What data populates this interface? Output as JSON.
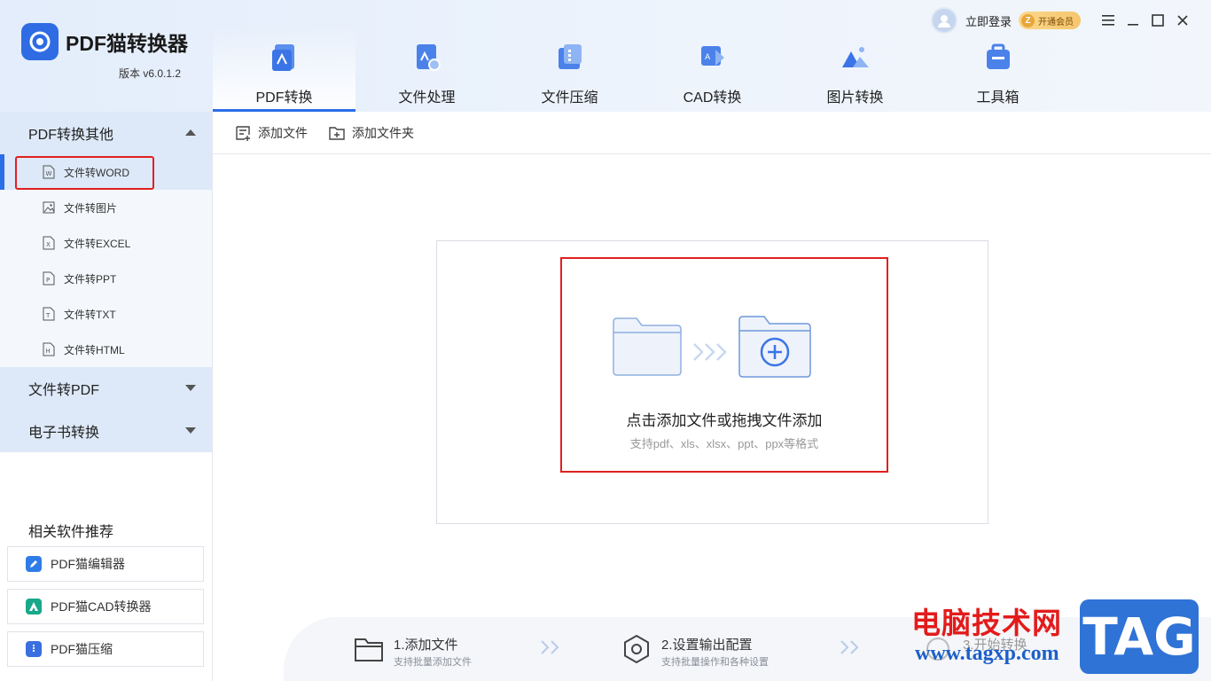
{
  "app": {
    "name": "PDF猫转换器",
    "version": "版本 v6.0.1.2"
  },
  "top_right": {
    "login": "立即登录",
    "vip_icon": "Z",
    "vip": "开通会员"
  },
  "nav_tabs": [
    {
      "label": "PDF转换",
      "icon": "pdf-convert-icon",
      "active": true
    },
    {
      "label": "文件处理",
      "icon": "file-process-icon",
      "active": false
    },
    {
      "label": "文件压缩",
      "icon": "file-compress-icon",
      "active": false
    },
    {
      "label": "CAD转换",
      "icon": "cad-convert-icon",
      "active": false
    },
    {
      "label": "图片转换",
      "icon": "image-convert-icon",
      "active": false
    },
    {
      "label": "工具箱",
      "icon": "toolbox-icon",
      "active": false
    }
  ],
  "sidebar": {
    "groups": [
      {
        "label": "PDF转换其他",
        "expanded": true
      },
      {
        "label": "文件转PDF",
        "expanded": false
      },
      {
        "label": "电子书转换",
        "expanded": false
      }
    ],
    "items": [
      {
        "label": "文件转WORD",
        "icon_letter": "W",
        "active": true
      },
      {
        "label": "文件转图片",
        "icon_letter": "",
        "active": false
      },
      {
        "label": "文件转EXCEL",
        "icon_letter": "X",
        "active": false
      },
      {
        "label": "文件转PPT",
        "icon_letter": "P",
        "active": false
      },
      {
        "label": "文件转TXT",
        "icon_letter": "T",
        "active": false
      },
      {
        "label": "文件转HTML",
        "icon_letter": "H",
        "active": false
      }
    ],
    "recommend_title": "相关软件推荐",
    "recommend": [
      {
        "label": "PDF猫编辑器",
        "color": "#2f7ce8"
      },
      {
        "label": "PDF猫CAD转换器",
        "color": "#19a889"
      },
      {
        "label": "PDF猫压缩",
        "color": "#3a6fe0"
      }
    ]
  },
  "toolbar": {
    "add_file": "添加文件",
    "add_folder": "添加文件夹"
  },
  "drop_zone": {
    "title": "点击添加文件或拖拽文件添加",
    "subtitle": "支持pdf、xls、xlsx、ppt、ppx等格式"
  },
  "steps": [
    {
      "title": "1.添加文件",
      "sub": "支持批量添加文件"
    },
    {
      "title": "2.设置输出配置",
      "sub": "支持批量操作和各种设置"
    },
    {
      "title": "3.开始转换",
      "sub": ""
    }
  ],
  "watermark": {
    "cn": "电脑技术网",
    "url": "www.tagxp.com",
    "tag": "TAG"
  },
  "colors": {
    "accent": "#2a6ee8",
    "highlight_border": "#e02020",
    "sidebar_active": "#dde9f8"
  }
}
